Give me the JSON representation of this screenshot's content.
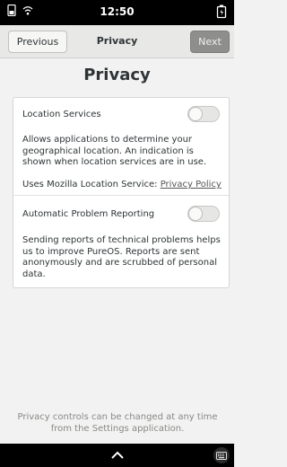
{
  "status_bar": {
    "time": "12:50",
    "icons": [
      "phone-icon",
      "wifi-icon",
      "battery-icon"
    ]
  },
  "header": {
    "previous_label": "Previous",
    "title": "Privacy",
    "next_label": "Next"
  },
  "main": {
    "title": "Privacy",
    "location": {
      "label": "Location Services",
      "enabled": false,
      "description": "Allows applications to determine your geographical location. An indication is shown when location services are in use.",
      "service_text": "Uses Mozilla Location Service: ",
      "policy_link": "Privacy Policy"
    },
    "reporting": {
      "label": "Automatic Problem Reporting",
      "enabled": false,
      "description": "Sending reports of technical problems helps us to improve PureOS. Reports are sent anonymously and are scrubbed of personal data."
    }
  },
  "footer": {
    "note": "Privacy controls can be changed at any time from the Settings application."
  },
  "bottom_bar": {
    "icons": [
      "chevron-up-icon",
      "keyboard-icon"
    ]
  }
}
